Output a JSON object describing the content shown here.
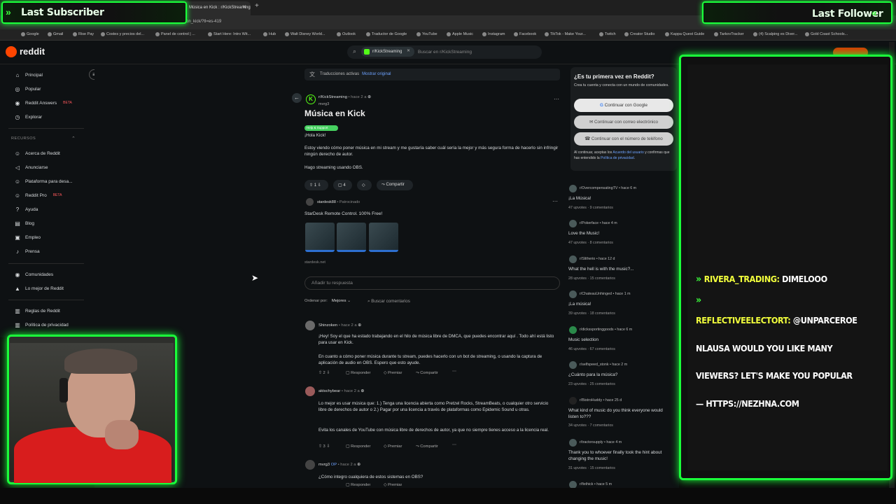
{
  "browser": {
    "tab_title": "Música en Kick : r/KickStreaming",
    "url_fragment": "on_kick/?tl=es-419",
    "bookmarks": [
      "Google",
      "Gmail",
      "Rise Pay",
      "Costes y precios del...",
      "Panel de control | ...",
      "Start Here: Intro Wit...",
      "Hub",
      "Walt Disney World...",
      "Outlook",
      "Traductor de Google",
      "YouTube",
      "Apple Music",
      "Instagram",
      "Facebook",
      "TikTok - Make Your...",
      "Twitch",
      "Creator Studio",
      "Kappa Quest Guide",
      "TarkovTracker",
      "(4) Scalping es Diver...",
      "Gold Coast Schools..."
    ]
  },
  "header": {
    "logo": "reddit",
    "search_chip": "r/KickStreaming",
    "search_placeholder": "Buscar en r/KickStreaming"
  },
  "sidebar": {
    "items": [
      {
        "label": "Principal",
        "icon": "home-icon"
      },
      {
        "label": "Popular",
        "icon": "popular-icon"
      },
      {
        "label": "Reddit Answers",
        "badge": "BETA",
        "icon": "answers-icon"
      },
      {
        "label": "Explorar",
        "icon": "explore-icon"
      }
    ],
    "resources_header": "RECURSOS",
    "resources": [
      {
        "label": "Acerca de Reddit"
      },
      {
        "label": "Anunciarse"
      },
      {
        "label": "Plataforma para desa..."
      },
      {
        "label": "Reddit Pro",
        "badge": "BETA"
      },
      {
        "label": "Ayuda"
      },
      {
        "label": "Blog"
      },
      {
        "label": "Empleo"
      },
      {
        "label": "Prensa"
      }
    ],
    "community": [
      {
        "label": "Comunidades"
      },
      {
        "label": "Lo mejor de Reddit"
      }
    ],
    "policies": [
      {
        "label": "Reglas de Reddit"
      },
      {
        "label": "Política de privacidad"
      }
    ]
  },
  "post": {
    "translation_label": "Traducciones activas",
    "translation_link": "Mostrar original",
    "subreddit": "r/KickStreaming",
    "age": "• hace 2 a",
    "author": "mvrg3",
    "title": "Música en Kick",
    "flair": "Help & Support",
    "p1": "¡Hola Kick!",
    "p2": "Estoy viendo cómo poner música en mi stream y me gustaría saber cuál sería la mejor y más segura forma de hacerlo sin infringir ningún derecho de autor.",
    "p3": "Hago streaming usando OBS.",
    "votes": "1",
    "comments": "4",
    "share": "Compartir"
  },
  "ad": {
    "user": "stardesk88",
    "tag": "• Patrocinado",
    "title": "StarDesk Remote Control. 100% Free!",
    "url": "stardesk.net"
  },
  "reply_placeholder": "Añadir tu respuesta",
  "sort": {
    "label": "Ordenar por:",
    "value": "Mejores"
  },
  "comment_search": "Buscar comentarios",
  "comments": [
    {
      "user": "Shinzoken",
      "age": "• hace 2 a",
      "text1": "¡Hey! Soy el que ha estado trabajando en el hilo de música libre de DMCA, que puedes encontrar aquí . Todo ahí está listo para usar en Kick.",
      "text2": "En cuanto a cómo poner música durante tu stream, puedes hacerlo con un bot de streaming, o usando la captura de aplicación de audio en OBS. Espero que esto ayude.",
      "votes": "2",
      "reply": "Responder",
      "award": "Premiar",
      "share": "Compartir"
    },
    {
      "user": "aktschybear",
      "age": "• hace 2 a",
      "text1": "Lo mejor es usar música que: 1.) Tenga una licencia abierta como Pretzel Rocks, StreamBeats, o cualquier otro servicio libre de derechos de autor o 2.) Pagar por una licencia a través de plataformas como Epidemic Sound u otras.",
      "text2": "Evita los canales de YouTube con música libre de derechos de autor, ya que no siempre tienes acceso a la licencia real.",
      "votes": "3",
      "reply": "Responder",
      "award": "Premiar",
      "share": "Compartir"
    },
    {
      "user": "mvrg3",
      "op": "OP",
      "age": "• hace 2 a",
      "text1": "¿Cómo integro cualquiera de estos sistemas en OBS?",
      "reply": "Responder",
      "award": "Premiar"
    }
  ],
  "signup": {
    "title": "¿Es tu primera vez en Reddit?",
    "subtitle": "Crea tu cuenta y conecta con un mundo de comunidades.",
    "google": "Continuar con Google",
    "email": "Continuar con correo electrónico",
    "phone": "Continuar con el número de teléfono",
    "legal_prefix": "Al continuar, aceptas los",
    "legal_terms": "Acuerdo del usuario",
    "legal_mid": "y confirmas que has entendido la",
    "legal_privacy": "Política de privacidad",
    "legal_end": "."
  },
  "related": [
    {
      "sub": "r/OvercompensatingTV",
      "age": "• hace 6 m",
      "title": "¡La Música!",
      "upvotes": "47 upvotes",
      "comments": "9 comentarios"
    },
    {
      "sub": "r/Pokerface",
      "age": "• hace 4 m",
      "title": "Love the Music!",
      "upvotes": "47 upvotes",
      "comments": "8 comentarios"
    },
    {
      "sub": "r/Slitherio",
      "age": "• hace 12 d",
      "title": "What the hell is with the music?...",
      "upvotes": "28 upvotes",
      "comments": "15 comentarios"
    },
    {
      "sub": "r/ChateauUnhinged",
      "age": "• hace 1 m",
      "title": "¡La música!",
      "upvotes": "39 upvotes",
      "comments": "18 comentarios"
    },
    {
      "sub": "r/dickssportinggoods",
      "age": "• hace 6 m",
      "title": "Music selection",
      "upvotes": "46 upvotes",
      "comments": "67 comentarios"
    },
    {
      "sub": "r/selfspeed_stonk",
      "age": "• hace 2 m",
      "title": "¿Cuánto para la música?",
      "upvotes": "23 upvotes",
      "comments": "25 comentarios"
    },
    {
      "sub": "r/BistroHuddy",
      "age": "• hace 25 d",
      "title": "What kind of music do you think everyone would listen to???",
      "upvotes": "34 upvotes",
      "comments": "7 comentarios"
    },
    {
      "sub": "r/tractorsupply",
      "age": "• hace 4 m",
      "title": "Thank you to whoever finally took the hint about changing the music!",
      "upvotes": "31 upvotes",
      "comments": "15 comentarios"
    },
    {
      "sub": "r/fixthick",
      "age": "• hace 5 m",
      "title": "",
      "upvotes": "",
      "comments": ""
    }
  ],
  "overlay": {
    "last_subscriber": "Last Subscriber",
    "last_follower": "Last Follower",
    "chat": [
      {
        "name": "RIVERA_TRADING:",
        "msg": "DIMELOOO"
      },
      {
        "name": "",
        "msg": ""
      },
      {
        "name": "REFLECTIVEELECTORT:",
        "msg": "@UNPARCEROE"
      },
      {
        "name": "",
        "msg": "NLAUSA WOULD YOU LIKE MANY"
      },
      {
        "name": "",
        "msg": "VIEWERS? LET'S MAKE YOU POPULAR"
      },
      {
        "name": "",
        "msg": "— HTTPS://NEZHNA.COM"
      }
    ],
    "accent": "#1aff3a"
  }
}
